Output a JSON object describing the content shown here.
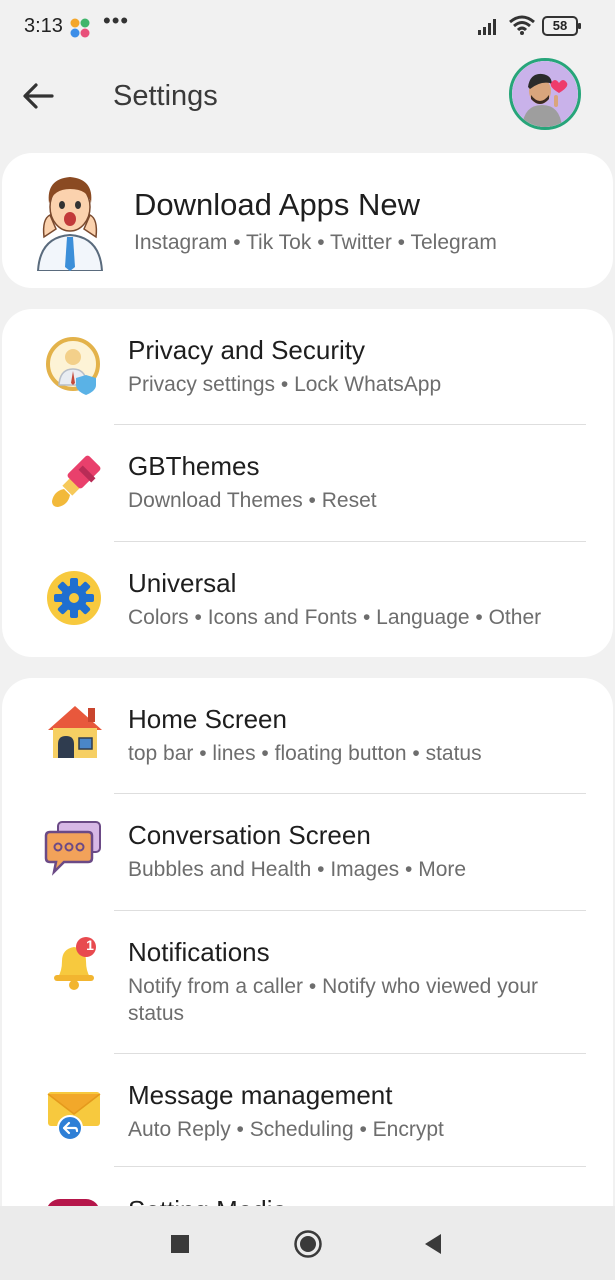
{
  "status_bar": {
    "time": "3:13",
    "dots": "•••",
    "battery": "58"
  },
  "header": {
    "title": "Settings"
  },
  "download_card": {
    "title": "Download Apps New",
    "subtitle": "Instagram • Tik Tok • Twitter • Telegram"
  },
  "group1": [
    {
      "title": "Privacy and Security",
      "subtitle": "Privacy settings • Lock WhatsApp",
      "icon": "privacy-icon"
    },
    {
      "title": "GBThemes",
      "subtitle": "Download Themes • Reset",
      "icon": "paintbrush-icon"
    },
    {
      "title": "Universal",
      "subtitle": "Colors • Icons and Fonts • Language • Other",
      "icon": "gear-icon"
    }
  ],
  "group2": [
    {
      "title": "Home Screen",
      "subtitle": "top bar • lines • floating button • status",
      "icon": "house-icon"
    },
    {
      "title": "Conversation Screen",
      "subtitle": "Bubbles and Health • Images • More",
      "icon": "chat-bubbles-icon"
    },
    {
      "title": "Notifications",
      "subtitle": "Notify from a caller • Notify who viewed your status",
      "icon": "bell-icon",
      "badge": "1"
    },
    {
      "title": "Message management",
      "subtitle": "Auto Reply • Scheduling • Encrypt",
      "icon": "envelope-icon"
    },
    {
      "title": "Setting Media",
      "subtitle": "",
      "icon": "media-icon"
    }
  ],
  "colors": {
    "accent": "#27a57a",
    "background": "#f1f1f1",
    "card": "#ffffff",
    "subtitle": "#6d6d6d"
  }
}
